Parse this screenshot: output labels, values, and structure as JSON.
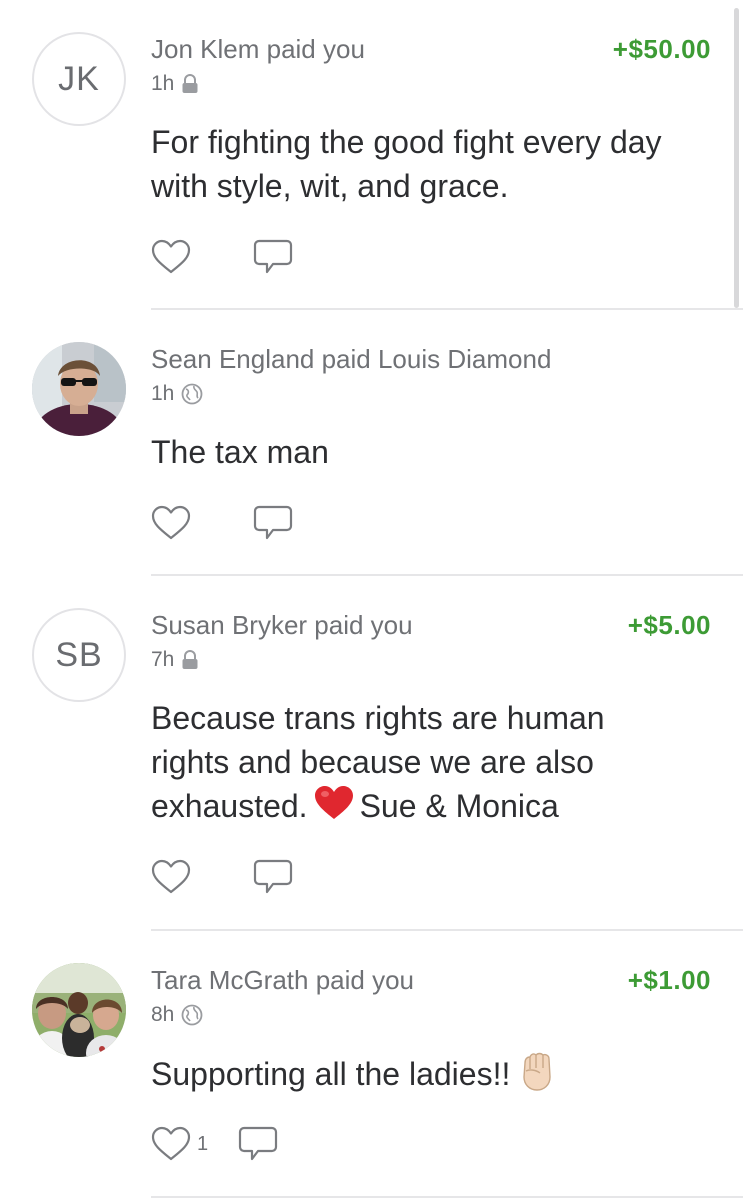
{
  "feed": {
    "stories": [
      {
        "avatar_type": "initials",
        "avatar_initials": "JK",
        "title": "Jon Klem paid you",
        "amount": "+$50.00",
        "time": "1h",
        "privacy_icon": "lock-icon",
        "message": "For fighting the good fight every day with style, wit, and grace.",
        "like_count": ""
      },
      {
        "avatar_type": "photo",
        "title": "Sean England paid Louis Diamond",
        "amount": "",
        "time": "1h",
        "privacy_icon": "globe-icon",
        "message": "The tax man",
        "like_count": ""
      },
      {
        "avatar_type": "initials",
        "avatar_initials": "SB",
        "title": "Susan Bryker paid you",
        "amount": "+$5.00",
        "time": "7h",
        "privacy_icon": "lock-icon",
        "message_part1": "Because trans rights are human rights and because we are also exhausted.",
        "message_emoji": "heart-emoji",
        "message_part2": "Sue & Monica",
        "like_count": ""
      },
      {
        "avatar_type": "photo",
        "title": "Tara McGrath paid you",
        "amount": "+$1.00",
        "time": "8h",
        "privacy_icon": "globe-icon",
        "message": "Supporting all the ladies!!",
        "message_emoji": "raised-fist-emoji",
        "like_count": "1"
      }
    ]
  },
  "colors": {
    "amount_green": "#3d9b35",
    "meta_gray": "#6f7175",
    "divider": "#e6e6e8"
  }
}
